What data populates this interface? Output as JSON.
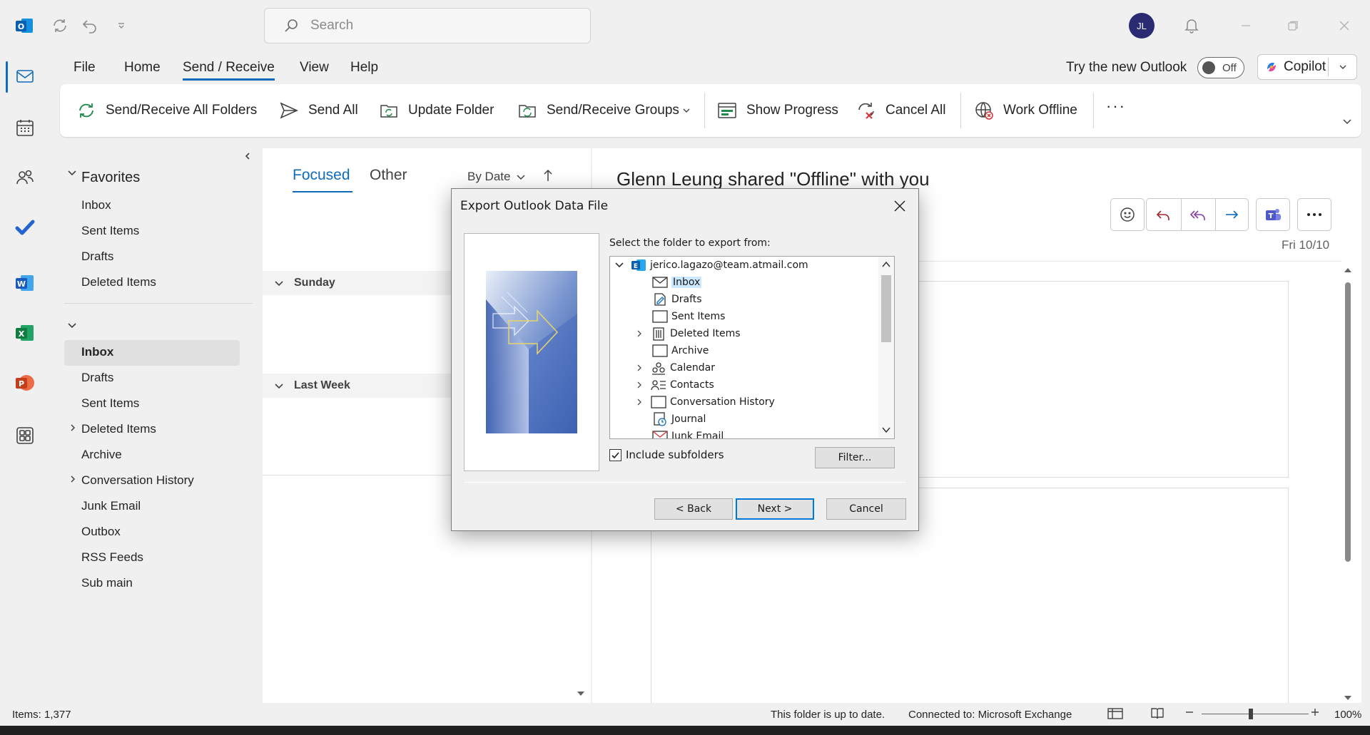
{
  "titlebar": {
    "search_placeholder": "Search",
    "avatar_initials": "JL"
  },
  "menu": {
    "tabs": [
      "File",
      "Home",
      "Send / Receive",
      "View",
      "Help"
    ],
    "try_new_outlook": "Try the new Outlook",
    "toggle_label": "Off",
    "copilot_label": "Copilot"
  },
  "ribbon": {
    "send_receive_all": "Send/Receive All Folders",
    "send_all": "Send All",
    "update_folder": "Update Folder",
    "send_receive_groups": "Send/Receive Groups",
    "show_progress": "Show Progress",
    "cancel_all": "Cancel All",
    "work_offline": "Work Offline",
    "more": "···"
  },
  "folders": {
    "favorites_label": "Favorites",
    "favorites": [
      "Inbox",
      "Sent Items",
      "Drafts",
      "Deleted Items"
    ],
    "account_folders": [
      "Inbox",
      "Drafts",
      "Sent Items",
      "Deleted Items",
      "Archive",
      "Conversation History",
      "Junk Email",
      "Outbox",
      "RSS Feeds",
      "Sub main"
    ],
    "selected": "Inbox"
  },
  "message_list": {
    "tab_focused": "Focused",
    "tab_other": "Other",
    "sort_label": "By Date",
    "group_sunday": "Sunday",
    "group_last_week": "Last Week"
  },
  "reading": {
    "subject": "Glenn Leung shared \"Offline\" with you",
    "date": "Fri 10/10"
  },
  "status": {
    "items": "Items: 1,377",
    "folder_status": "This folder is up to date.",
    "connection": "Connected to: Microsoft Exchange",
    "zoom": "100%"
  },
  "dialog": {
    "title": "Export Outlook Data File",
    "prompt": "Select the folder to export from:",
    "account": "jerico.lagazo@team.atmail.com",
    "tree_items": [
      "Inbox",
      "Drafts",
      "Sent Items",
      "Deleted Items",
      "Archive",
      "Calendar",
      "Contacts",
      "Conversation History",
      "Journal",
      "Junk Email"
    ],
    "include_subfolders": "Include subfolders",
    "filter": "Filter...",
    "back": "< Back",
    "next": "Next >",
    "cancel": "Cancel"
  },
  "colors": {
    "accent": "#0f6cbd",
    "avatar_bg": "#2b2b73"
  }
}
